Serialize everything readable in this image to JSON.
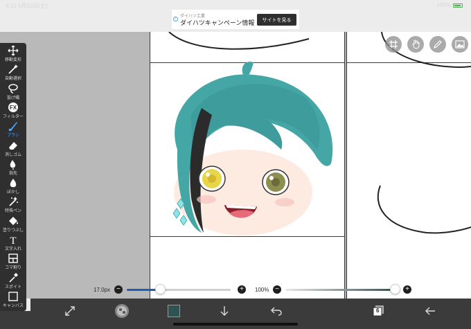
{
  "status_bar": {
    "time": "4:12 4月10日(土)",
    "battery": "100%"
  },
  "ad": {
    "small_text": "ダイハツ工業",
    "title": "ダイハツキャンペーン情報",
    "button": "サイトを見る"
  },
  "toolbar": {
    "tools": [
      {
        "label": "移動変形",
        "icon": "move-icon"
      },
      {
        "label": "自動選択",
        "icon": "magic-wand-icon"
      },
      {
        "label": "投げ縄",
        "icon": "lasso-icon"
      },
      {
        "label": "フィルター",
        "icon": "fx-icon",
        "glyph": "FX"
      },
      {
        "label": "ブラシ",
        "icon": "brush-icon",
        "active": true
      },
      {
        "label": "消しゴム",
        "icon": "eraser-icon"
      },
      {
        "label": "指先",
        "icon": "finger-icon"
      },
      {
        "label": "ぼかし",
        "icon": "blur-icon"
      },
      {
        "label": "特殊ペン",
        "icon": "special-pen-icon"
      },
      {
        "label": "塗りつぶし",
        "icon": "fill-icon"
      },
      {
        "label": "文字入れ",
        "icon": "text-icon",
        "glyph": "T"
      },
      {
        "label": "コマ割り",
        "icon": "frame-divider-icon"
      },
      {
        "label": "スポイト",
        "icon": "eyedropper-icon"
      },
      {
        "label": "キャンバス",
        "icon": "canvas-icon"
      }
    ]
  },
  "sliders": {
    "brush_size": {
      "value_label": "17.0px",
      "fraction": 0.32
    },
    "opacity": {
      "value_label": "100%",
      "fraction": 1.0
    }
  },
  "bottom_bar": {
    "layer_count": "6",
    "color_swatch": "#2f5253"
  },
  "colors": {
    "accent": "#4aa3ff",
    "hair": "#45a6a6",
    "toolbar": "#2f2f2f"
  }
}
